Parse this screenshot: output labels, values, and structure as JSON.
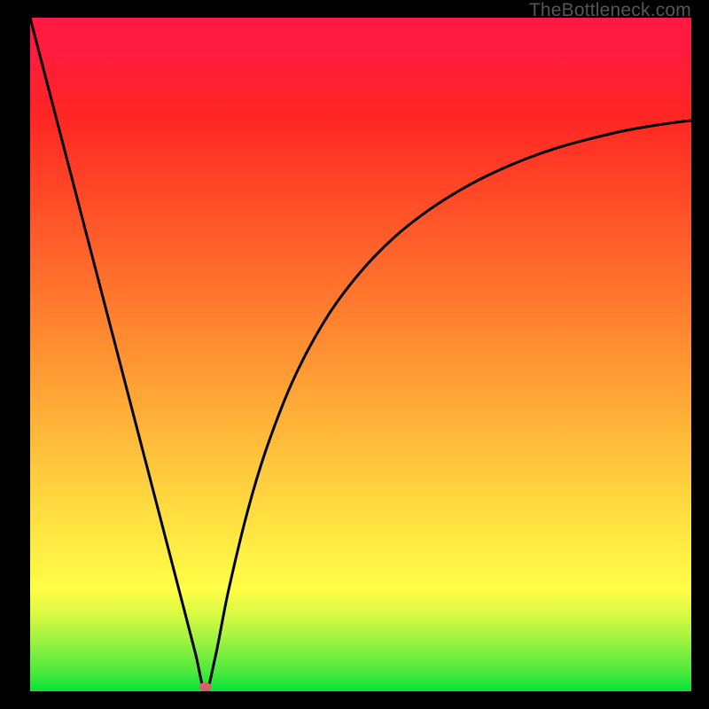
{
  "watermark": "TheBottleneck.com",
  "chart_data": {
    "type": "line",
    "title": "",
    "xlabel": "",
    "ylabel": "",
    "xlim": [
      0,
      100
    ],
    "ylim": [
      0,
      105
    ],
    "grid": false,
    "gradient_bands": [
      {
        "y": 0,
        "color": "#07e33a"
      },
      {
        "y": 3,
        "color": "#4be93c"
      },
      {
        "y": 6,
        "color": "#7def3f"
      },
      {
        "y": 9,
        "color": "#aef441"
      },
      {
        "y": 12,
        "color": "#d9f943"
      },
      {
        "y": 16,
        "color": "#fffe46"
      },
      {
        "y": 30,
        "color": "#ffd73f"
      },
      {
        "y": 45,
        "color": "#ffa936"
      },
      {
        "y": 60,
        "color": "#ff7c2e"
      },
      {
        "y": 75,
        "color": "#ff5028"
      },
      {
        "y": 90,
        "color": "#ff2523"
      },
      {
        "y": 100,
        "color": "#ff1b3f"
      }
    ],
    "marker": {
      "x": 26.5,
      "y": 0.7,
      "color": "#d4626c"
    },
    "series": [
      {
        "name": "curve",
        "x": [
          0,
          5,
          10,
          15,
          20,
          23,
          25,
          26.5,
          28,
          30,
          33,
          36,
          40,
          45,
          50,
          55,
          60,
          65,
          70,
          75,
          80,
          85,
          90,
          95,
          100
        ],
        "values": [
          105,
          85.2,
          65.4,
          45.6,
          25.8,
          13.9,
          5.9,
          0.0,
          5.3,
          15.7,
          28.5,
          38.6,
          49.0,
          58.5,
          65.4,
          70.7,
          74.8,
          78.1,
          80.8,
          83.0,
          84.8,
          86.2,
          87.4,
          88.3,
          89.0
        ]
      }
    ]
  }
}
